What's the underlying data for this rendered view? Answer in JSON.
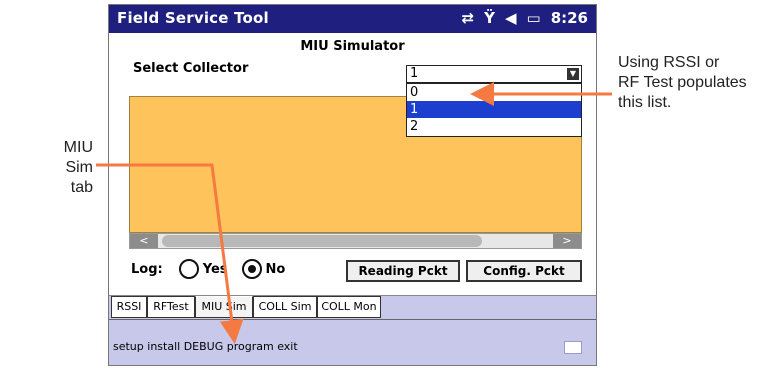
{
  "window": {
    "app_title": "Field Service Tool",
    "status_icons": [
      "sync-icon",
      "no-signal-icon",
      "speaker-icon",
      "battery-icon"
    ],
    "status_glyphs": [
      "⇄",
      "Ÿ",
      "◀",
      "▭"
    ],
    "time": "8:26"
  },
  "screen": {
    "heading": "MIU Simulator",
    "select_label": "Select Collector",
    "combo_value": "1",
    "dropdown_options": [
      "0",
      "1",
      "2"
    ],
    "selected_option": "1",
    "scrollbar_left": "<",
    "scrollbar_right": ">",
    "log_label": "Log:",
    "log_yes": "Yes",
    "log_no": "No",
    "log_selected": "No",
    "reading_button": "Reading Pckt",
    "config_button": "Config. Pckt"
  },
  "tabs": [
    "RSSI",
    "RFTest",
    "MIU Sim",
    "COLL Sim",
    "COLL Mon"
  ],
  "active_tab": "MIU Sim",
  "menu": [
    "setup",
    "install",
    "DEBUG",
    "program",
    "exit"
  ],
  "annotations": {
    "left_line1": "MIU Sim",
    "left_line2": "tab",
    "right_line1": "Using RSSI or",
    "right_line2": "RF Test populates",
    "right_line3": "this list."
  },
  "colors": {
    "titlebar": "#1e1f7e",
    "panel": "#fec35a",
    "selection": "#1c3fcf",
    "tab_strip": "#c8c8ea",
    "callout": "#f47a42"
  }
}
